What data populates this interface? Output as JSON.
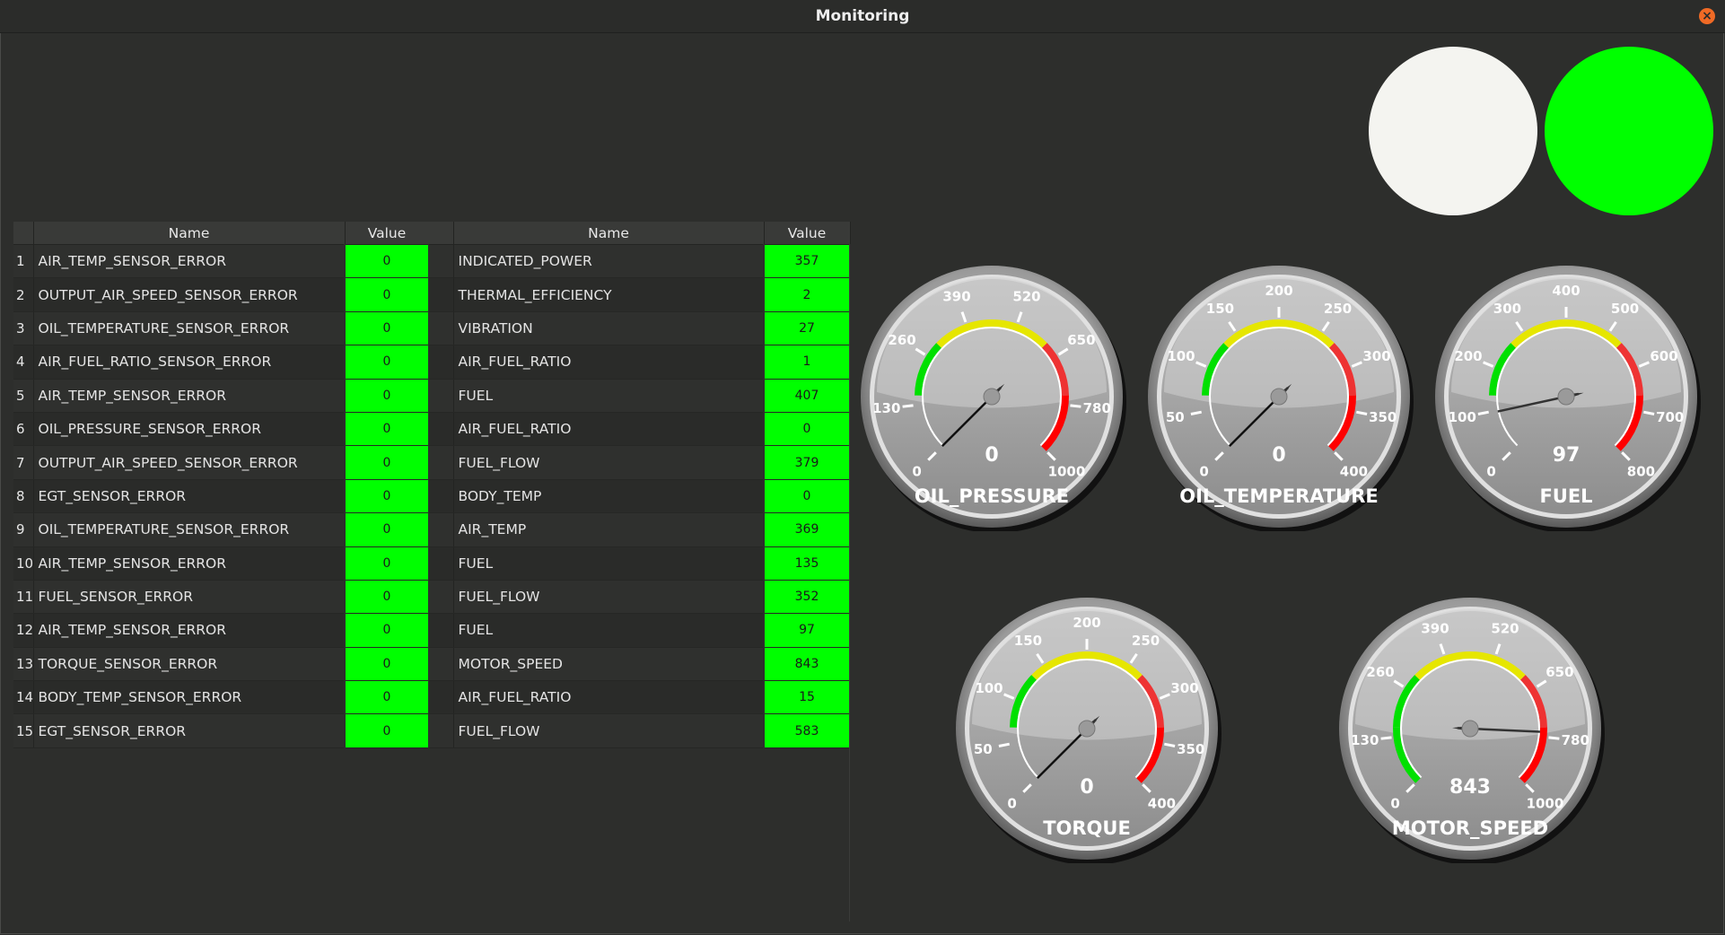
{
  "window": {
    "title": "Monitoring",
    "close_icon": "close-icon"
  },
  "lamps": [
    {
      "name": "status-lamp-1",
      "color": "#f4f4f0"
    },
    {
      "name": "status-lamp-2",
      "color": "#00ff00"
    }
  ],
  "left_table": {
    "headers": {
      "name": "Name",
      "value": "Value"
    },
    "rows": [
      {
        "index": "1",
        "name": "AIR_TEMP_SENSOR_ERROR",
        "value": "0"
      },
      {
        "index": "2",
        "name": "OUTPUT_AIR_SPEED_SENSOR_ERROR",
        "value": "0"
      },
      {
        "index": "3",
        "name": "OIL_TEMPERATURE_SENSOR_ERROR",
        "value": "0"
      },
      {
        "index": "4",
        "name": "AIR_FUEL_RATIO_SENSOR_ERROR",
        "value": "0"
      },
      {
        "index": "5",
        "name": "AIR_TEMP_SENSOR_ERROR",
        "value": "0"
      },
      {
        "index": "6",
        "name": "OIL_PRESSURE_SENSOR_ERROR",
        "value": "0"
      },
      {
        "index": "7",
        "name": "OUTPUT_AIR_SPEED_SENSOR_ERROR",
        "value": "0"
      },
      {
        "index": "8",
        "name": "EGT_SENSOR_ERROR",
        "value": "0"
      },
      {
        "index": "9",
        "name": "OIL_TEMPERATURE_SENSOR_ERROR",
        "value": "0"
      },
      {
        "index": "10",
        "name": "AIR_TEMP_SENSOR_ERROR",
        "value": "0"
      },
      {
        "index": "11",
        "name": "FUEL_SENSOR_ERROR",
        "value": "0"
      },
      {
        "index": "12",
        "name": "AIR_TEMP_SENSOR_ERROR",
        "value": "0"
      },
      {
        "index": "13",
        "name": "TORQUE_SENSOR_ERROR",
        "value": "0"
      },
      {
        "index": "14",
        "name": "BODY_TEMP_SENSOR_ERROR",
        "value": "0"
      },
      {
        "index": "15",
        "name": "EGT_SENSOR_ERROR",
        "value": "0"
      }
    ]
  },
  "right_table": {
    "headers": {
      "name": "Name",
      "value": "Value"
    },
    "rows": [
      {
        "name": "INDICATED_POWER",
        "value": "357"
      },
      {
        "name": "THERMAL_EFFICIENCY",
        "value": "2"
      },
      {
        "name": "VIBRATION",
        "value": "27"
      },
      {
        "name": "AIR_FUEL_RATIO",
        "value": "1"
      },
      {
        "name": "FUEL",
        "value": "407"
      },
      {
        "name": "AIR_FUEL_RATIO",
        "value": "0"
      },
      {
        "name": "FUEL_FLOW",
        "value": "379"
      },
      {
        "name": "BODY_TEMP",
        "value": "0"
      },
      {
        "name": "AIR_TEMP",
        "value": "369"
      },
      {
        "name": "FUEL",
        "value": "135"
      },
      {
        "name": "FUEL_FLOW",
        "value": "352"
      },
      {
        "name": "FUEL",
        "value": "97"
      },
      {
        "name": "MOTOR_SPEED",
        "value": "843"
      },
      {
        "name": "AIR_FUEL_RATIO",
        "value": "15"
      },
      {
        "name": "FUEL_FLOW",
        "value": "583"
      }
    ]
  },
  "gauges": [
    {
      "id": "oil-pressure",
      "label": "OIL_PRESSURE",
      "value": 0,
      "min": 0,
      "max": 1000,
      "ticks": [
        "0",
        "130",
        "260",
        "390",
        "520",
        "650",
        "780",
        "1000"
      ],
      "show_green": false,
      "needle_color": "#111111"
    },
    {
      "id": "oil-temperature",
      "label": "OIL_TEMPERATURE",
      "value": 0,
      "min": 0,
      "max": 400,
      "ticks": [
        "0",
        "50",
        "100",
        "150",
        "200",
        "250",
        "300",
        "350",
        "400"
      ],
      "show_green": false,
      "needle_color": "#111111"
    },
    {
      "id": "fuel",
      "label": "FUEL",
      "value": 97,
      "min": 0,
      "max": 800,
      "ticks": [
        "0",
        "100",
        "200",
        "300",
        "400",
        "500",
        "600",
        "700",
        "800"
      ],
      "show_green": false,
      "needle_color": "#333333"
    },
    {
      "id": "torque",
      "label": "TORQUE",
      "value": 0,
      "min": 0,
      "max": 400,
      "ticks": [
        "0",
        "50",
        "100",
        "150",
        "200",
        "250",
        "300",
        "350",
        "400"
      ],
      "show_green": false,
      "needle_color": "#111111"
    },
    {
      "id": "motor-speed",
      "label": "MOTOR_SPEED",
      "value": 843,
      "min": 0,
      "max": 1000,
      "ticks": [
        "0",
        "130",
        "260",
        "390",
        "520",
        "650",
        "780",
        "1000"
      ],
      "show_green": true,
      "needle_color": "#333333"
    }
  ]
}
